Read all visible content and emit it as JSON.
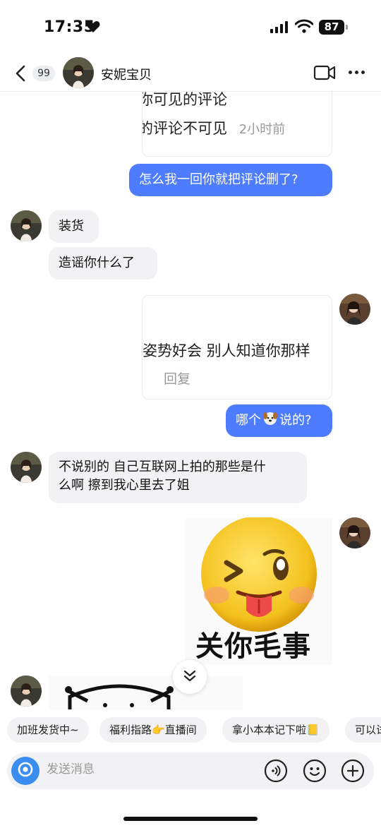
{
  "status_bar": {
    "time": "17:35",
    "battery": "87"
  },
  "header": {
    "unread_count": "99",
    "contact_name": "安妮宝贝"
  },
  "messages": {
    "quote1_line1": "你可见的评论",
    "quote1_line2": "的评论不可见",
    "quote1_time": "2小时前",
    "out1": "怎么我一回你就把评论删了?",
    "in1": "装货",
    "in2": "造谣你什么了",
    "quote2_line1": "姿势好会 别人知道你那样",
    "quote2_reply": "回复",
    "out2_before": "哪个",
    "out2_after": "说的?",
    "in3_line1": "不说别的 自己互联网上拍的那些是什",
    "in3_line2": "么啊 擦到我心里去了姐",
    "sticker_caption": "关你毛事"
  },
  "quick_replies": [
    "加班发货中~",
    "福利指路👉直播间",
    "拿小本本记下啦📒",
    "可以试"
  ],
  "input": {
    "placeholder": "发送消息"
  },
  "icons": {
    "back": "chevron-left-icon",
    "video": "video-call-icon",
    "more": "more-dots-icon",
    "camera": "camera-icon",
    "voice": "voice-icon",
    "emoji": "emoji-icon",
    "add": "plus-icon",
    "scroll": "chevron-double-down-icon"
  },
  "colors": {
    "outgoing_bubble": "#4d7cfe",
    "incoming_bubble": "#f2f2f4",
    "camera_button": "#3b8ef0"
  }
}
